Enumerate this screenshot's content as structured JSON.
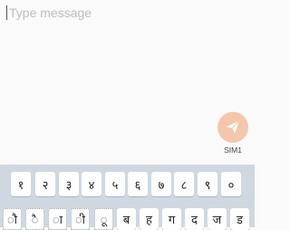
{
  "compose": {
    "placeholder": "Type message",
    "sim_label": "SIM1",
    "send_icon": "paper-plane-icon"
  },
  "keyboard": {
    "row1": [
      "१",
      "२",
      "३",
      "४",
      "५",
      "६",
      "७",
      "८",
      "९",
      "०"
    ],
    "row2": [
      "ौ",
      "ै",
      "ा",
      "ी",
      "ू",
      "ब",
      "ह",
      "ग",
      "द",
      "ज",
      "ड"
    ]
  },
  "colors": {
    "send_button": "#f5c6ab",
    "keyboard_bg": "#cfd8e0",
    "key_bg": "#ffffff"
  }
}
